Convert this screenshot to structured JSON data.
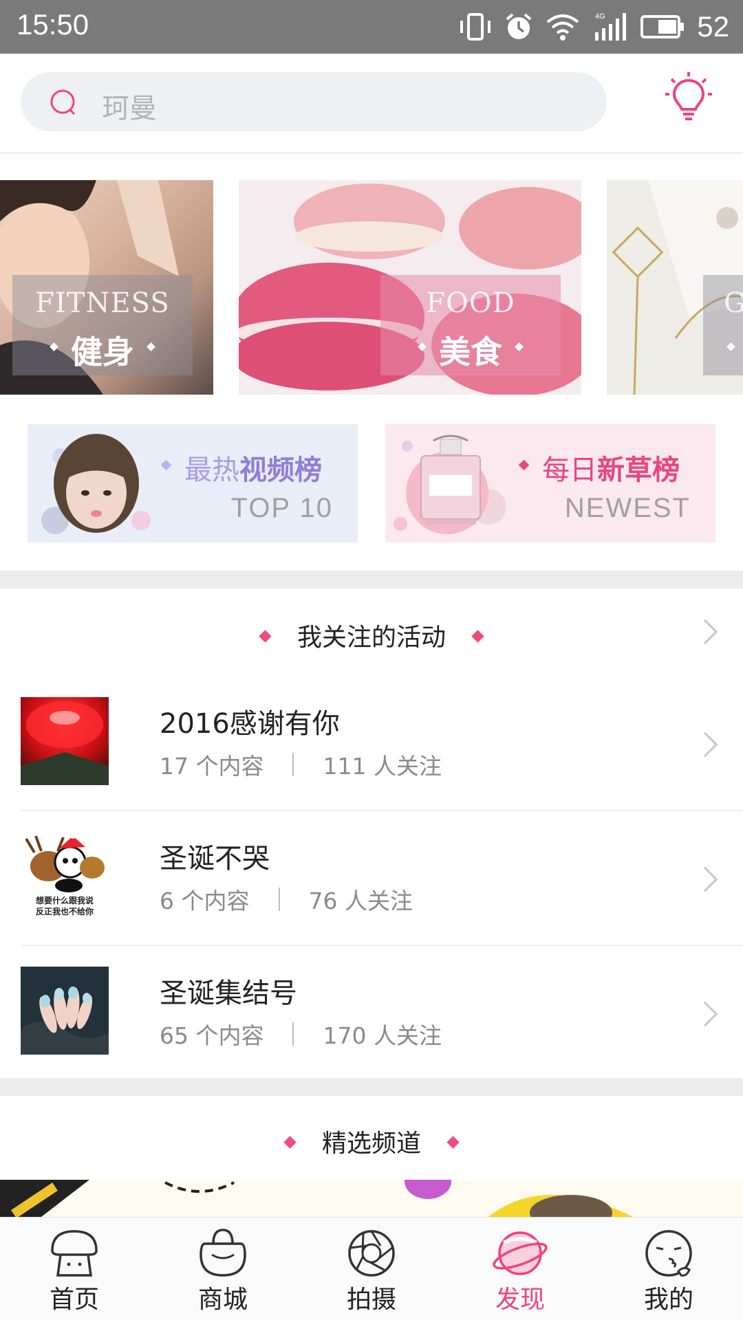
{
  "status_bar": {
    "time": "15:50",
    "battery": "52",
    "network": "4G"
  },
  "search": {
    "placeholder": "珂曼"
  },
  "categories": [
    {
      "en": "FITNESS",
      "cn": "健身"
    },
    {
      "en": "FOOD",
      "cn": "美食"
    },
    {
      "en": "G",
      "cn": ""
    }
  ],
  "rankings": [
    {
      "title_light": "最热",
      "title_bold": "视频榜",
      "sub": "TOP  10",
      "accent": "#8f7fd6"
    },
    {
      "title_light": "每日",
      "title_bold": "新草榜",
      "sub": "NEWEST",
      "accent": "#e8467f"
    }
  ],
  "followed_section": {
    "title": "我关注的活动"
  },
  "activities": [
    {
      "name": "2016感谢有你",
      "contents": "17 个内容",
      "followers": "111 人关注"
    },
    {
      "name": "圣诞不哭",
      "contents": "6 个内容",
      "followers": "76 人关注",
      "thumb_caption_1": "想要什么跟我说",
      "thumb_caption_2": "反正我也不给你"
    },
    {
      "name": "圣诞集结号",
      "contents": "65 个内容",
      "followers": "170 人关注"
    }
  ],
  "channels_section": {
    "title": "精选频道"
  },
  "bottom_nav": [
    {
      "label": "首页",
      "icon": "mushroom-home-icon"
    },
    {
      "label": "商城",
      "icon": "shopping-bag-icon"
    },
    {
      "label": "拍摄",
      "icon": "camera-aperture-icon"
    },
    {
      "label": "发现",
      "icon": "planet-discover-icon",
      "active": true
    },
    {
      "label": "我的",
      "icon": "face-profile-icon"
    }
  ],
  "colors": {
    "accent": "#f0427a",
    "status_bar": "#7a7a7a",
    "band": "#ececef"
  }
}
